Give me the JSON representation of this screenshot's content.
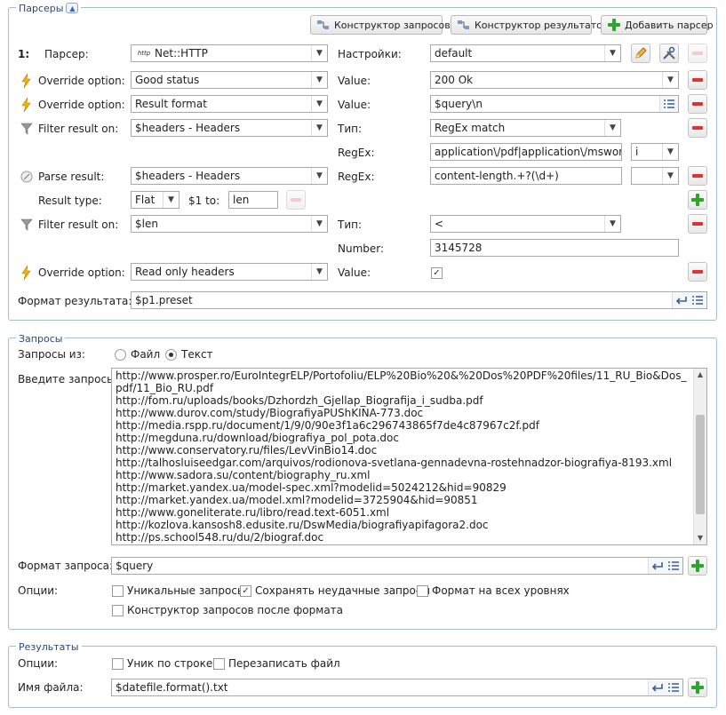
{
  "parsers": {
    "legend": "Парсеры",
    "toolbar": {
      "query_builder": "Конструктор запросов",
      "result_builder": "Конструктор результатов",
      "add_parser": "Добавить парсер"
    },
    "row1": {
      "num": "1:",
      "label": "Парсер:",
      "parser": "Net::HTTP",
      "settings_label": "Настройки:",
      "settings": "default"
    },
    "row2": {
      "label": "Override option:",
      "option": "Good status",
      "value_label": "Value:",
      "value": "200 Ok"
    },
    "row3": {
      "label": "Override option:",
      "option": "Result format",
      "value_label": "Value:",
      "value": "$query\\n"
    },
    "row4": {
      "label": "Filter result on:",
      "option": "$headers - Headers",
      "type_label": "Тип:",
      "type": "RegEx match",
      "regex_label": "RegEx:",
      "regex": "application\\/pdf|application\\/msword",
      "flags": "i"
    },
    "row5": {
      "label": "Parse result:",
      "option": "$headers - Headers",
      "regex_label": "RegEx:",
      "regex": "content-length.+?(\\d+)",
      "flags": "",
      "result_type_label": "Result type:",
      "result_type": "Flat",
      "to_label": "$1 to:",
      "to_value": "len"
    },
    "row6": {
      "label": "Filter result on:",
      "option": "$len",
      "type_label": "Тип:",
      "type": "<",
      "number_label": "Number:",
      "number": "3145728"
    },
    "row7": {
      "label": "Override option:",
      "option": "Read only headers",
      "value_label": "Value:"
    },
    "result_format": {
      "label": "Формат результата:",
      "value": "$p1.preset"
    }
  },
  "queries": {
    "legend": "Запросы",
    "from_label": "Запросы из:",
    "radio_file": "Файл",
    "radio_text": "Текст",
    "enter_label": "Введите запросы:",
    "lines": [
      "http://www.prosper.ro/EuroIntegrELP/Portofoliu/ELP%20Bio%20&%20Dos%20PDF%20files/11_RU_Bio&Dos_pdf/11_Bio_RU.pdf",
      "http://fom.ru/uploads/books/Dzhordzh_Gjellap_Biografija_i_sudba.pdf",
      "http://www.durov.com/study/BiografiyaPUShKINA-773.doc",
      "http://media.rspp.ru/document/1/9/0/90e3f1a6c296743865f7de4c87967c2f.pdf",
      "http://megduna.ru/download/biografiya_pol_pota.doc",
      "http://www.conservatory.ru/files/LevVinBio14.doc",
      "http://talhosluiseedgar.com/arquivos/rodionova-svetlana-gennadevna-rostehnadzor-biografiya-8193.xml",
      "http://www.sadora.su/content/biography_ru.xml",
      "http://market.yandex.ua/model-spec.xml?modelid=5024212&hid=90829",
      "http://market.yandex.ua/model.xml?modelid=3725904&hid=90851",
      "http://www.goneliterate.ru/libro/read.text-6051.xml",
      "http://kozlova.kansosh8.edusite.ru/DswMedia/biografiyapifagora2.doc",
      "http://ps.school548.ru/du/2/biograf.doc"
    ],
    "format_label": "Формат запроса:",
    "format_value": "$query",
    "options_label": "Опции:",
    "opt_unique": "Уникальные запросы",
    "opt_save_failed": "Сохранять неудачные запросы",
    "opt_all_levels": "Формат на всех уровнях",
    "opt_builder_after": "Конструктор запросов после формата"
  },
  "results": {
    "legend": "Результаты",
    "options_label": "Опции:",
    "opt_unique_line": "Уник по строке",
    "opt_overwrite": "Перезаписать файл",
    "filename_label": "Имя файла:",
    "filename": "$datefile.format().txt"
  }
}
